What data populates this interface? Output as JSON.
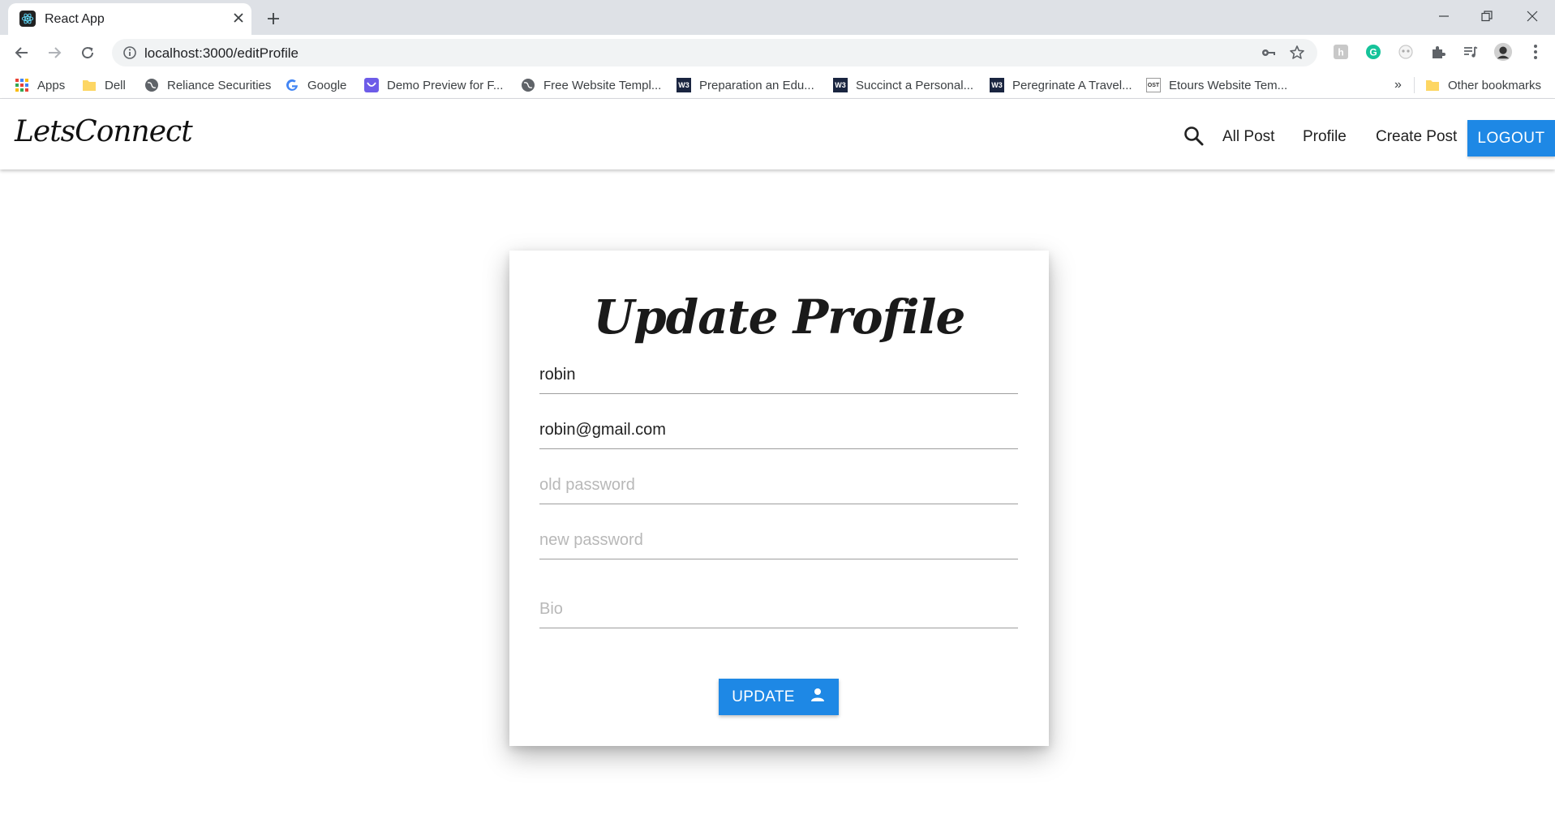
{
  "browser": {
    "tab_title": "React App",
    "url": "localhost:3000/editProfile",
    "bookmarks": [
      {
        "label": "Apps",
        "icon": "apps-grid-icon"
      },
      {
        "label": "Dell",
        "icon": "folder-icon"
      },
      {
        "label": "Reliance Securities",
        "icon": "globe-icon"
      },
      {
        "label": "Google",
        "icon": "google-icon"
      },
      {
        "label": "Demo Preview for F...",
        "icon": "demo-preview-icon"
      },
      {
        "label": "Free Website Templ...",
        "icon": "globe-icon"
      },
      {
        "label": "Preparation an Edu...",
        "icon": "w3-icon"
      },
      {
        "label": "Succinct a Personal...",
        "icon": "w3-icon"
      },
      {
        "label": "Peregrinate A Travel...",
        "icon": "w3-icon"
      },
      {
        "label": "Etours Website Tem...",
        "icon": "ost-icon"
      }
    ],
    "overflow_label": "»",
    "other_bookmarks_label": "Other bookmarks"
  },
  "navbar": {
    "brand": "LetsConnect",
    "links": [
      "All Post",
      "Profile",
      "Create Post"
    ],
    "logout_label": "LOGOUT"
  },
  "form": {
    "title": "Update Profile",
    "name_value": "robin",
    "email_value": "robin@gmail.com",
    "old_password_placeholder": "old password",
    "new_password_placeholder": "new password",
    "bio_placeholder": "Bio",
    "update_label": "UPDATE"
  },
  "colors": {
    "primary": "#1e88e5",
    "tabstrip": "#dee1e6"
  }
}
